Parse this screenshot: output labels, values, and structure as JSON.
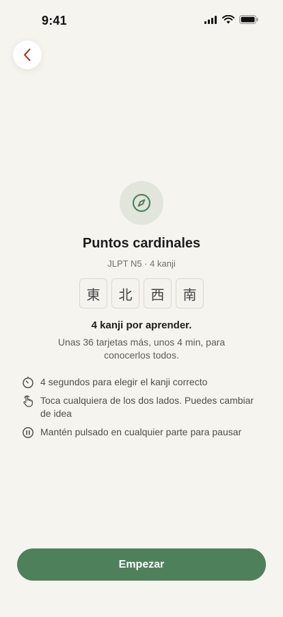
{
  "status_bar": {
    "time": "9:41"
  },
  "header": {
    "back_icon": "chevron-left-icon"
  },
  "lesson": {
    "icon": "compass-icon",
    "title": "Puntos cardinales",
    "subtitle": "JLPT N5 · 4 kanji",
    "kanji": [
      "東",
      "北",
      "西",
      "南"
    ],
    "count_line": "4 kanji por aprender.",
    "description": "Unas 36 tarjetas más, unos 4 min, para conocerlos todos."
  },
  "tips": [
    {
      "icon": "timer-icon",
      "text": "4 segundos para elegir el kanji correcto"
    },
    {
      "icon": "tap-hand-icon",
      "text": "Toca cualquiera de los dos lados. Puedes cambiar de idea"
    },
    {
      "icon": "pause-icon",
      "text": "Mantén pulsado en cualquier parte para pausar"
    }
  ],
  "actions": {
    "start_label": "Empezar"
  },
  "colors": {
    "background": "#f6f4ee",
    "accent_green": "#4f805c",
    "back_chevron": "#b23a2c",
    "icon_circle": "#e2e5dc"
  }
}
